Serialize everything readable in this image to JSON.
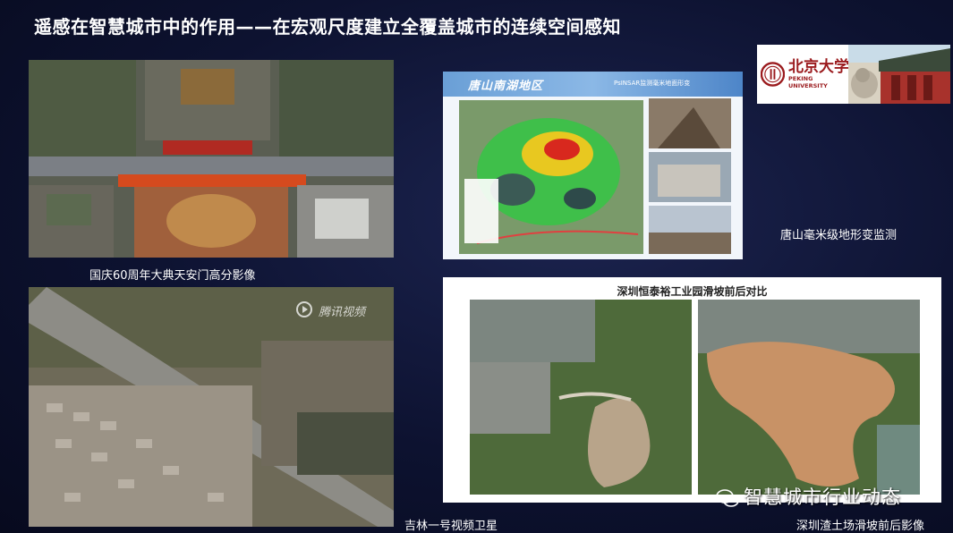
{
  "slide": {
    "title": "遥感在智慧城市中的作用——在宏观尺度建立全覆盖城市的连续空间感知"
  },
  "logo": {
    "cn": "北京大学",
    "en": "PEKING UNIVERSITY"
  },
  "panels": {
    "aerial": {
      "caption": "国庆60周年大典天安门高分影像"
    },
    "tangshan": {
      "title": "唐山南湖地区",
      "subtitle": "PsINSAR监测毫米地面形变",
      "caption": "唐山毫米级地形变监测"
    },
    "jilin": {
      "caption": "吉林一号视频卫星",
      "video_logo": "腾讯视频"
    },
    "shenzhen": {
      "title": "深圳恒泰裕工业园滑坡前后对比",
      "caption": "深圳渣土场滑坡前后影像"
    }
  },
  "watermark": {
    "text": "智慧城市行业动态"
  },
  "colors": {
    "background": "#0d1230",
    "logo_red": "#9b1b1e",
    "insar_header": "#6a9fd6"
  }
}
